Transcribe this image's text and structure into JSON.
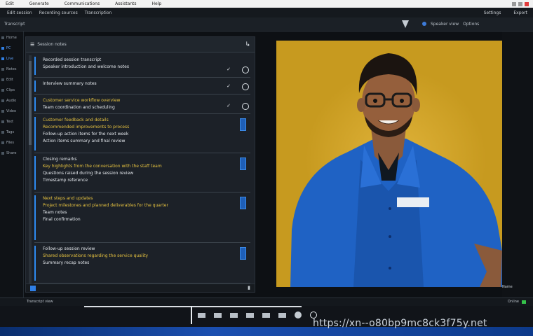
{
  "window": {
    "menu": [
      "Edit",
      "Generate",
      "Communications",
      "Assistants",
      "Help"
    ],
    "watermark": "https://xn--o80bp9mc8ck3f75y.net"
  },
  "toolbar": {
    "items": [
      "Edit session",
      "Recording sources",
      "Transcription"
    ],
    "right_items": [
      "Settings",
      "Export"
    ]
  },
  "header": {
    "left_label": "Transcript",
    "right_label": "Speaker view",
    "right_extra": "Options"
  },
  "sidebar": {
    "items": [
      {
        "label": "Home",
        "active": false
      },
      {
        "label": "PC",
        "active": true
      },
      {
        "label": "Live",
        "active": true
      },
      {
        "label": "Notes",
        "active": false
      },
      {
        "label": "Edit",
        "active": false
      },
      {
        "label": "Clips",
        "active": false
      },
      {
        "label": "Audio",
        "active": false
      },
      {
        "label": "Video",
        "active": false
      },
      {
        "label": "Text",
        "active": false
      },
      {
        "label": "Tags",
        "active": false
      },
      {
        "label": "Files",
        "active": false
      },
      {
        "label": "Share",
        "active": false
      }
    ]
  },
  "panel": {
    "title": "Session notes",
    "corner_icon": "pin-icon",
    "entries": [
      {
        "lines": [
          {
            "t": "Recorded session transcript",
            "c": "w"
          },
          {
            "t": "Speaker introduction and welcome notes",
            "c": "w"
          }
        ],
        "marks": true
      },
      {
        "lines": [
          {
            "t": "Interview summary notes",
            "c": "w"
          }
        ],
        "marks": true
      },
      {
        "lines": [
          {
            "t": "Customer service workflow overview",
            "c": "y"
          },
          {
            "t": "Team coordination and scheduling",
            "c": "w"
          }
        ],
        "marks": true
      },
      {
        "lines": [
          {
            "t": "Customer feedback and details",
            "c": "y"
          },
          {
            "t": "Recommended improvements to process",
            "c": "y"
          },
          {
            "t": "Follow-up action items for the next week",
            "c": "w"
          },
          {
            "t": "Action items summary and final review",
            "c": "w"
          }
        ],
        "marks": false
      },
      {
        "lines": [
          {
            "t": "Closing remarks",
            "c": "w"
          },
          {
            "t": "Key highlights from the conversation with the staff team",
            "c": "y"
          },
          {
            "t": "Questions raised during the session review",
            "c": "w"
          },
          {
            "t": "Timestamp reference",
            "c": "w"
          }
        ],
        "marks": false
      },
      {
        "lines": [
          {
            "t": "Next steps and updates",
            "c": "y"
          },
          {
            "t": "Project milestones and planned deliverables for the quarter",
            "c": "y"
          },
          {
            "t": "Team notes",
            "c": "w"
          },
          {
            "t": "Final confirmation",
            "c": "w"
          }
        ],
        "marks": false
      },
      {
        "lines": [
          {
            "t": "Follow-up session review",
            "c": "w"
          },
          {
            "t": "Shared observations regarding the service quality",
            "c": "y"
          },
          {
            "t": "Summary recap notes",
            "c": "w"
          }
        ],
        "marks": false
      }
    ]
  },
  "status": {
    "left": "Transcript view",
    "right": "Online"
  },
  "viewer": {
    "name_tag": "Name"
  },
  "colors": {
    "accent": "#2e8bf0",
    "highlight_text": "#e7c340",
    "viewer_bg": "#c79a1f",
    "shirt": "#1f62c4"
  }
}
